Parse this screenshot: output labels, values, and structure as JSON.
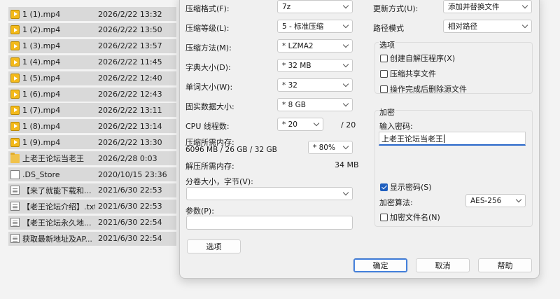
{
  "files": [
    {
      "name": "1 (1).mp4",
      "date": "2026/2/22 13:32",
      "icon": "video-file-icon"
    },
    {
      "name": "1 (2).mp4",
      "date": "2026/2/22 13:50",
      "icon": "video-file-icon"
    },
    {
      "name": "1 (3).mp4",
      "date": "2026/2/22 13:57",
      "icon": "video-file-icon"
    },
    {
      "name": "1 (4).mp4",
      "date": "2026/2/22 11:45",
      "icon": "video-file-icon"
    },
    {
      "name": "1 (5).mp4",
      "date": "2026/2/22 12:40",
      "icon": "video-file-icon"
    },
    {
      "name": "1 (6).mp4",
      "date": "2026/2/22 12:43",
      "icon": "video-file-icon"
    },
    {
      "name": "1 (7).mp4",
      "date": "2026/2/22 13:11",
      "icon": "video-file-icon"
    },
    {
      "name": "1 (8).mp4",
      "date": "2026/2/22 13:14",
      "icon": "video-file-icon"
    },
    {
      "name": "1 (9).mp4",
      "date": "2026/2/22 13:30",
      "icon": "video-file-icon"
    },
    {
      "name": "上老王论坛当老王",
      "date": "2026/2/28 0:03",
      "icon": "folder-icon"
    },
    {
      "name": ".DS_Store",
      "date": "2020/10/15 23:36",
      "icon": "file-icon"
    },
    {
      "name": "【来了就能下载和...",
      "date": "2021/6/30 22:53",
      "icon": "text-file-icon"
    },
    {
      "name": "【老王论坛介绍】.txt",
      "date": "2021/6/30 22:53",
      "icon": "text-file-icon"
    },
    {
      "name": "【老王论坛永久地...",
      "date": "2021/6/30 22:54",
      "icon": "text-file-icon"
    },
    {
      "name": "获取最新地址及AP...",
      "date": "2021/6/30 22:54",
      "icon": "text-file-icon"
    }
  ],
  "dialog": {
    "format_label": "压缩格式(F):",
    "format_value": "7z",
    "level_label": "压缩等级(L):",
    "level_value": "5 - 标准压缩",
    "method_label": "压缩方法(M):",
    "method_value": "* LZMA2",
    "dict_label": "字典大小(D):",
    "dict_value": "* 32 MB",
    "word_label": "单词大小(W):",
    "word_value": "* 32",
    "solid_label": "固实数据大小:",
    "solid_value": "* 8 GB",
    "threads_label": "CPU 线程数:",
    "threads_value": "* 20",
    "threads_max": "/ 20",
    "mem_comp_label": "压缩所需内存:",
    "mem_comp_value": "6096 MB / 26 GB / 32 GB",
    "mem_percent": "* 80%",
    "mem_decomp_label": "解压所需内存:",
    "mem_decomp_value": "34 MB",
    "split_label": "分卷大小，字节(V):",
    "split_value": "",
    "params_label": "参数(P):",
    "params_value": "",
    "options_button": "选项",
    "update_label": "更新方式(U):",
    "update_value": "添加并替换文件",
    "path_label": "路径模式",
    "path_value": "相对路径",
    "options_group": "选项",
    "opt_sfx": "创建自解压程序(X)",
    "opt_shared": "压缩共享文件",
    "opt_delete": "操作完成后删除源文件",
    "encrypt_group": "加密",
    "password_label": "输入密码:",
    "password_value": "上老王论坛当老王",
    "show_password": "显示密码(S)",
    "enc_method_label": "加密算法:",
    "enc_method_value": "AES-256",
    "encrypt_names": "加密文件名(N)",
    "ok": "确定",
    "cancel": "取消",
    "help": "帮助"
  }
}
